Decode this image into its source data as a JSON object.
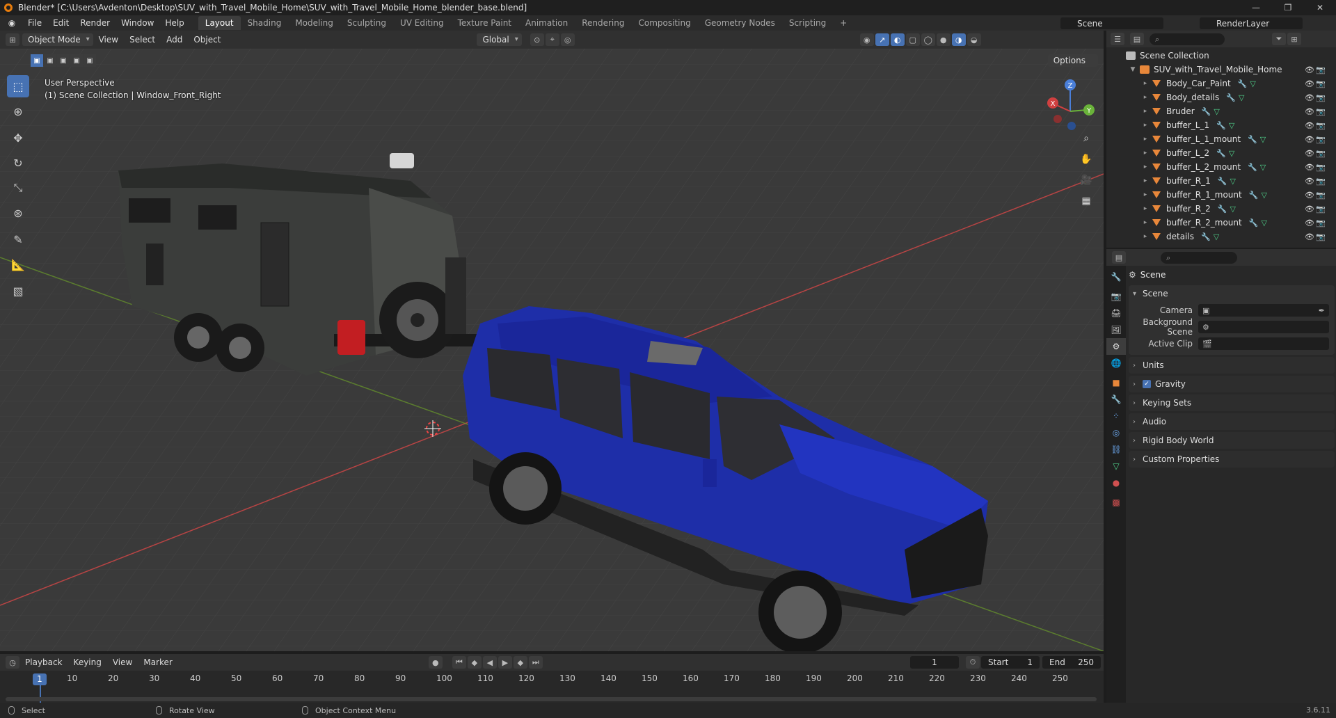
{
  "window": {
    "title": "Blender* [C:\\Users\\Avdenton\\Desktop\\SUV_with_Travel_Mobile_Home\\SUV_with_Travel_Mobile_Home_blender_base.blend]",
    "min": "—",
    "max": "❐",
    "close": "✕"
  },
  "menu": [
    "File",
    "Edit",
    "Render",
    "Window",
    "Help"
  ],
  "workspaces": [
    "Layout",
    "Shading",
    "Modeling",
    "Sculpting",
    "UV Editing",
    "Texture Paint",
    "Animation",
    "Rendering",
    "Compositing",
    "Geometry Nodes",
    "Scripting"
  ],
  "workspace_add": "+",
  "scene_selector": "Scene",
  "render_layer": "RenderLayer",
  "viewport_header": {
    "mode": "Object Mode",
    "menus": [
      "View",
      "Select",
      "Add",
      "Object"
    ],
    "transform": "Global",
    "options": "Options"
  },
  "viewport": {
    "perspective": "User Perspective",
    "collection": "(1) Scene Collection | Window_Front_Right",
    "gizmo": {
      "x": "X",
      "y": "Y",
      "z": "Z"
    }
  },
  "timeline": {
    "menus": [
      "Playback",
      "Keying",
      "View",
      "Marker"
    ],
    "current_frame": "1",
    "start_label": "Start",
    "start": "1",
    "end_label": "End",
    "end": "250",
    "ruler": [
      "10",
      "20",
      "30",
      "40",
      "50",
      "60",
      "70",
      "80",
      "90",
      "100",
      "110",
      "120",
      "130",
      "140",
      "150",
      "160",
      "170",
      "180",
      "190",
      "200",
      "210",
      "220",
      "230",
      "240",
      "250"
    ],
    "cursor_frame": "1"
  },
  "statusbar": {
    "select": "Select",
    "rotate": "Rotate View",
    "context": "Object Context Menu",
    "version": "3.6.11"
  },
  "outliner": {
    "root": "Scene Collection",
    "collection": "SUV_with_Travel_Mobile_Home",
    "items": [
      "Body_Car_Paint",
      "Body_details",
      "Bruder",
      "buffer_L_1",
      "buffer_L_1_mount",
      "buffer_L_2",
      "buffer_L_2_mount",
      "buffer_R_1",
      "buffer_R_1_mount",
      "buffer_R_2",
      "buffer_R_2_mount",
      "details"
    ]
  },
  "properties": {
    "title": "Scene",
    "panel": "Scene",
    "camera_label": "Camera",
    "bg_scene_label": "Background Scene",
    "active_clip_label": "Active Clip",
    "sections": [
      "Units",
      "Gravity",
      "Keying Sets",
      "Audio",
      "Rigid Body World",
      "Custom Properties"
    ]
  },
  "colors": {
    "accent": "#4772b3",
    "suv_body": "#1f2fa8",
    "trailer": "#3a3c3a",
    "grid": "#444444",
    "axis_x": "#c44040",
    "axis_y": "#6a9a2a"
  }
}
